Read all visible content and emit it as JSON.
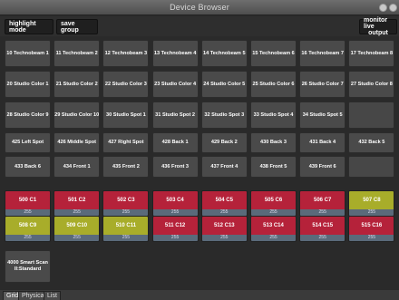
{
  "window": {
    "title": "Device Browser"
  },
  "toolbar": {
    "highlight_label": "highlight mode",
    "save_group_label": "save group",
    "monitor_line1": "monitor live",
    "monitor_line2": "output"
  },
  "rows": [
    [
      "10 Technobeam 1",
      "11 Technobeam 2",
      "12 Technobeam 3",
      "13 Technobeam 4",
      "14 Technobeam 5",
      "15 Technobeam 6",
      "16 Technobeam 7",
      "17 Technobeam 8"
    ],
    [
      "20 Studio Color 1",
      "21 Studio Color 2",
      "22 Studio Color 3",
      "23 Studio Color 4",
      "24 Studio Color 5",
      "25 Studio Color 6",
      "26 Studio Color 7",
      "27 Studio Color 8"
    ],
    [
      "28 Studio Color 9",
      "29 Studio Color 10",
      "30 Studio Spot 1",
      "31 Studio Spot 2",
      "32 Studio Spot 3",
      "33 Studio Spot 4",
      "34 Studio Spot 5",
      ""
    ],
    [
      "425 Left Spot",
      "426 Middle Spot",
      "427 Right Spot",
      "428 Back 1",
      "429 Back 2",
      "430 Back 3",
      "431 Back 4",
      "432 Back 5"
    ],
    [
      "433 Back 6",
      "434 Front 1",
      "435 Front 2",
      "436 Front 3",
      "437 Front 4",
      "438 Front 5",
      "439 Front 6",
      ""
    ]
  ],
  "selected_rows": [
    [
      {
        "label": "500 C1",
        "value": "255",
        "color": "red"
      },
      {
        "label": "501 C2",
        "value": "255",
        "color": "red"
      },
      {
        "label": "502 C3",
        "value": "255",
        "color": "red"
      },
      {
        "label": "503 C4",
        "value": "255",
        "color": "red"
      },
      {
        "label": "504 C5",
        "value": "255",
        "color": "red"
      },
      {
        "label": "505 C6",
        "value": "255",
        "color": "red"
      },
      {
        "label": "506 C7",
        "value": "255",
        "color": "red"
      },
      {
        "label": "507 C8",
        "value": "255",
        "color": "olive"
      }
    ],
    [
      {
        "label": "508 C9",
        "value": "255",
        "color": "olive"
      },
      {
        "label": "509 C10",
        "value": "255",
        "color": "olive"
      },
      {
        "label": "510 C11",
        "value": "255",
        "color": "olive"
      },
      {
        "label": "511 C12",
        "value": "255",
        "color": "red"
      },
      {
        "label": "512 C13",
        "value": "255",
        "color": "red"
      },
      {
        "label": "513 C14",
        "value": "255",
        "color": "red"
      },
      {
        "label": "514 C15",
        "value": "255",
        "color": "red"
      },
      {
        "label": "515 C16",
        "value": "255",
        "color": "red"
      }
    ]
  ],
  "last_row": [
    "4000 Smart Scan II:Standard"
  ],
  "tabs": [
    "Grid",
    "Physical",
    "List"
  ],
  "colors": {
    "red": "#b5223a",
    "olive": "#a8ad2a"
  }
}
